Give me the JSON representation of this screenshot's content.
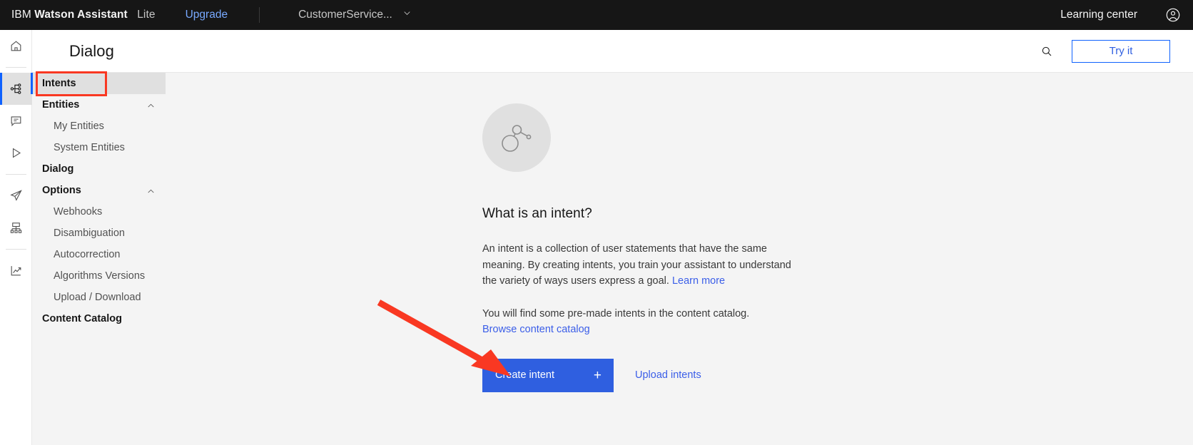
{
  "topbar": {
    "brand_prefix": "IBM",
    "brand_name": "Watson Assistant",
    "plan": "Lite",
    "upgrade_label": "Upgrade",
    "skill_name": "CustomerService...",
    "chevron_icon": "chevron-down-icon",
    "learning_center_label": "Learning center",
    "account_icon": "user-avatar-icon"
  },
  "rail": {
    "items": [
      {
        "icon": "home-icon",
        "name": "home",
        "active": false
      },
      {
        "icon": "skill-tree-icon",
        "name": "skills",
        "active": true
      },
      {
        "icon": "chat-icon",
        "name": "assistants",
        "active": false
      },
      {
        "icon": "play-icon",
        "name": "preview",
        "active": false
      },
      {
        "icon": "paper-plane-icon",
        "name": "publish",
        "active": false
      },
      {
        "icon": "integrations-icon",
        "name": "integrations",
        "active": false
      },
      {
        "icon": "analytics-icon",
        "name": "analytics",
        "active": false
      }
    ]
  },
  "pagebar": {
    "title": "Dialog",
    "search_icon": "search-icon",
    "try_it_label": "Try it"
  },
  "sidebar": {
    "items": [
      {
        "label": "Intents",
        "level": "top",
        "selected": true,
        "caret": ""
      },
      {
        "label": "Entities",
        "level": "top",
        "selected": false,
        "caret": "chevron-up-icon"
      },
      {
        "label": "My Entities",
        "level": "sub",
        "selected": false,
        "caret": ""
      },
      {
        "label": "System Entities",
        "level": "sub",
        "selected": false,
        "caret": ""
      },
      {
        "label": "Dialog",
        "level": "top",
        "selected": false,
        "caret": ""
      },
      {
        "label": "Options",
        "level": "top",
        "selected": false,
        "caret": "chevron-up-icon"
      },
      {
        "label": "Webhooks",
        "level": "sub",
        "selected": false,
        "caret": ""
      },
      {
        "label": "Disambiguation",
        "level": "sub",
        "selected": false,
        "caret": ""
      },
      {
        "label": "Autocorrection",
        "level": "sub",
        "selected": false,
        "caret": ""
      },
      {
        "label": "Algorithms Versions",
        "level": "sub",
        "selected": false,
        "caret": ""
      },
      {
        "label": "Upload / Download",
        "level": "sub",
        "selected": false,
        "caret": ""
      },
      {
        "label": "Content Catalog",
        "level": "top",
        "selected": false,
        "caret": ""
      }
    ]
  },
  "empty_state": {
    "illustration_icon": "intent-node-graph-icon",
    "heading": "What is an intent?",
    "paragraph_1": "An intent is a collection of user statements that have the same meaning. By creating intents, you train your assistant to understand the variety of ways users express a goal.",
    "learn_more_label": "Learn more",
    "paragraph_2": "You will find some pre-made intents in the content catalog.",
    "browse_catalog_label": "Browse content catalog",
    "create_intent_label": "Create intent",
    "create_intent_icon": "plus-icon",
    "upload_intents_label": "Upload intents"
  },
  "annotations": {
    "highlight_rect_target": "Intents",
    "arrow_target": "Create intent",
    "color": "#f93822"
  },
  "colors": {
    "accent_blue": "#0f62fe",
    "button_blue": "#2f5fe0",
    "link_blue": "#3b5ee8",
    "header_black": "#161616",
    "page_bg": "#f4f4f4",
    "annotation_red": "#f93822"
  }
}
